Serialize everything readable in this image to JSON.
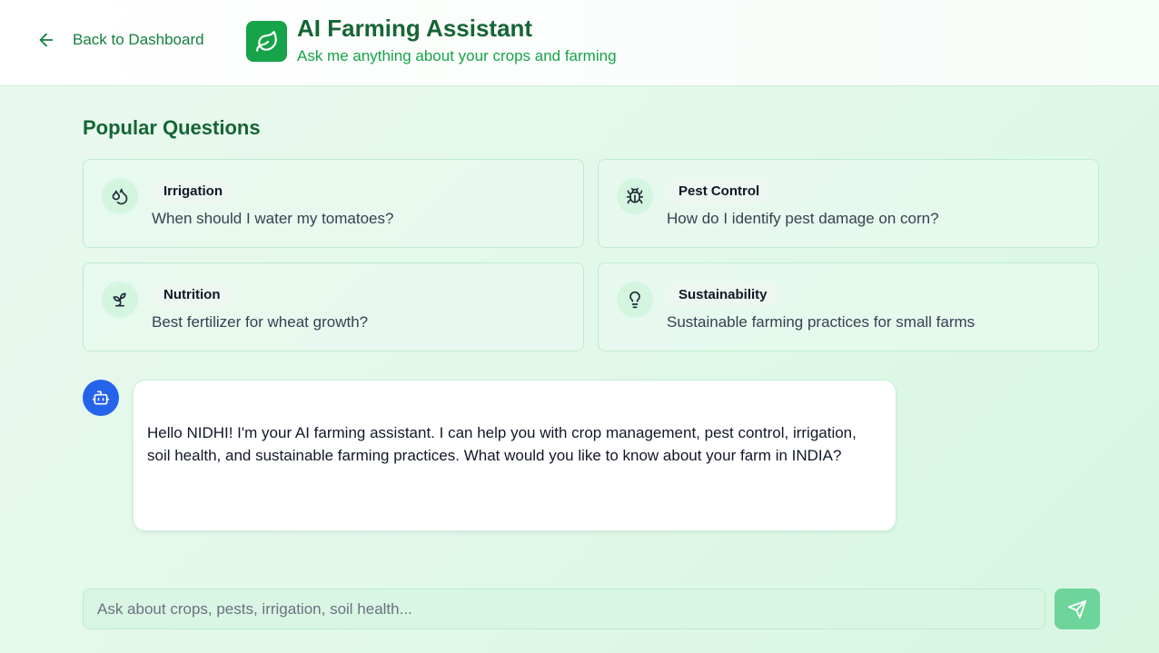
{
  "header": {
    "back_label": "Back to Dashboard",
    "title": "AI Farming Assistant",
    "subtitle": "Ask me anything about your crops and farming",
    "logo_icon": "leaf-icon",
    "back_icon": "arrow-left-icon"
  },
  "popular": {
    "title": "Popular Questions",
    "items": [
      {
        "tag": "Irrigation",
        "question": "When should I water my tomatoes?",
        "icon": "droplets-icon"
      },
      {
        "tag": "Pest Control",
        "question": "How do I identify pest damage on corn?",
        "icon": "bug-icon"
      },
      {
        "tag": "Nutrition",
        "question": "Best fertilizer for wheat growth?",
        "icon": "sprout-icon"
      },
      {
        "tag": "Sustainability",
        "question": "Sustainable farming practices for small farms",
        "icon": "lightbulb-icon"
      }
    ]
  },
  "chat": {
    "messages": [
      {
        "sender": "bot",
        "avatar_icon": "bot-icon",
        "text": "Hello NIDHI! I'm your AI farming assistant. I can help you with crop management, pest control, irrigation, soil health, and sustainable farming practices. What would you like to know about your farm in INDIA?"
      }
    ],
    "input_placeholder": "Ask about crops, pests, irrigation, soil health...",
    "input_value": "",
    "send_icon": "send-icon"
  },
  "colors": {
    "brand_green": "#16a34a",
    "dark_green": "#166534",
    "bot_blue": "#2563eb",
    "send_button": "#6dd49a"
  }
}
